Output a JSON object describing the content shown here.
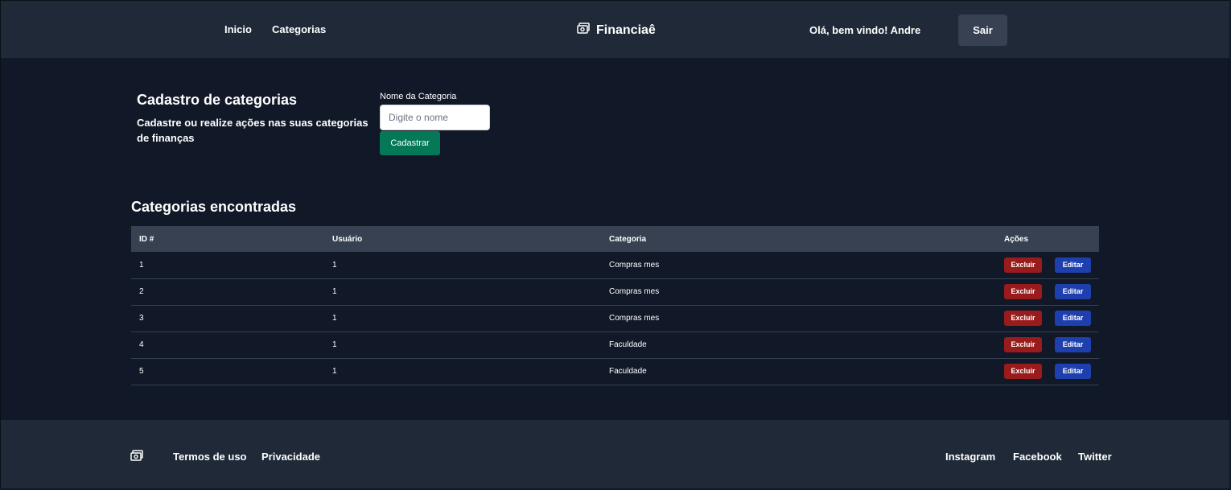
{
  "header": {
    "nav": [
      "Inicio",
      "Categorias"
    ],
    "brand": "Financiaê",
    "greeting_prefix": "Olá, bem vindo! ",
    "user_name": "Andre",
    "logout_label": "Sair"
  },
  "form": {
    "title": "Cadastro de categorias",
    "description": "Cadastre ou realize ações nas suas categorias de finanças",
    "field_label": "Nome da Categoria",
    "input_placeholder": "Digite o nome",
    "input_value": "",
    "submit_label": "Cadastrar"
  },
  "table": {
    "title": "Categorias encontradas",
    "headers": [
      "ID #",
      "Usuário",
      "Categoria",
      "Ações"
    ],
    "rows": [
      {
        "id": "1",
        "user": "1",
        "category": "Compras mes"
      },
      {
        "id": "2",
        "user": "1",
        "category": "Compras mes"
      },
      {
        "id": "3",
        "user": "1",
        "category": "Compras mes"
      },
      {
        "id": "4",
        "user": "1",
        "category": "Faculdade"
      },
      {
        "id": "5",
        "user": "1",
        "category": "Faculdade"
      }
    ],
    "delete_label": "Excluir",
    "edit_label": "Editar"
  },
  "footer": {
    "links_left": [
      "Termos de uso",
      "Privacidade"
    ],
    "links_right": [
      "Instagram",
      "Facebook",
      "Twitter"
    ]
  },
  "colors": {
    "page_bg": "#111827",
    "bar_bg": "#1f2937",
    "table_header_bg": "#374151",
    "submit": "#047857",
    "delete": "#991b1b",
    "edit": "#1e40af"
  },
  "icons": {
    "brand": "cash-icon",
    "footer": "cash-icon"
  }
}
